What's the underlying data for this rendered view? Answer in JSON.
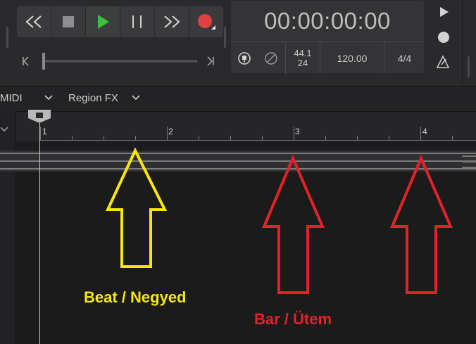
{
  "transport": {
    "buttons": [
      "rewind",
      "stop",
      "play",
      "pause",
      "fast-forward",
      "record"
    ],
    "play_color": "#35c33a",
    "record_color": "#e24040"
  },
  "lcd": {
    "time": "00:00:00:00",
    "sample_rate": "44.1",
    "bit_depth": "24",
    "tempo": "120.00",
    "time_signature": "4/4"
  },
  "toolbar": {
    "midi_label": "MIDI",
    "region_fx_label": "Region FX"
  },
  "ruler": {
    "bars": [
      "1",
      "2",
      "3",
      "4"
    ]
  },
  "annotations": {
    "beat_label": "Beat / Negyed",
    "bar_label": "Bar / Ütem",
    "beat_color": "#f5e612",
    "bar_color": "#e3222a"
  }
}
